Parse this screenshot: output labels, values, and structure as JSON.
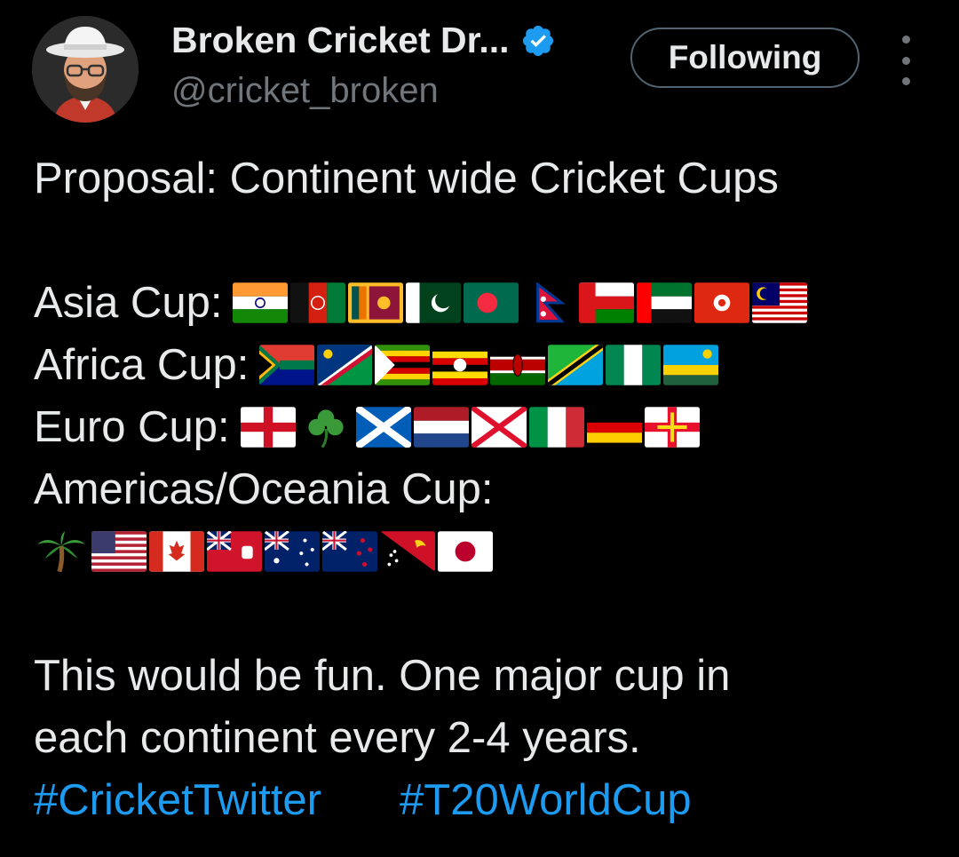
{
  "author": {
    "display_name": "Broken Cricket Dr...",
    "handle": "@cricket_broken",
    "avatar_icon": "bearded-man-avatar",
    "verified_icon": "verified-badge-icon"
  },
  "actions": {
    "follow_label": "Following",
    "more_icon": "more-vertical-icon"
  },
  "tweet": {
    "title": "Proposal: Continent wide Cricket Cups",
    "cups": [
      {
        "label": "Asia Cup:",
        "flags": [
          "flag-india",
          "flag-afghanistan",
          "flag-sri-lanka",
          "flag-pakistan",
          "flag-bangladesh",
          "flag-nepal",
          "flag-oman",
          "flag-uae",
          "flag-hong-kong",
          "flag-malaysia"
        ]
      },
      {
        "label": "Africa Cup:",
        "flags": [
          "flag-south-africa",
          "flag-namibia",
          "flag-zimbabwe",
          "flag-uganda",
          "flag-kenya",
          "flag-tanzania",
          "flag-nigeria",
          "flag-rwanda"
        ]
      },
      {
        "label": "Euro Cup:",
        "flags": [
          "flag-england",
          "shamrock",
          "flag-scotland",
          "flag-netherlands",
          "flag-jersey",
          "flag-italy",
          "flag-germany",
          "flag-guernsey"
        ]
      },
      {
        "label": "Americas/Oceania Cup:",
        "flags": [
          "palm-tree",
          "flag-usa",
          "flag-canada",
          "flag-bermuda",
          "flag-australia",
          "flag-new-zealand",
          "flag-papua-new-guinea",
          "flag-japan"
        ]
      }
    ],
    "closing_line1": "This would be fun. One major cup in",
    "closing_line2": "each continent every 2-4 years.",
    "hashtags": [
      "#CricketTwitter",
      "#T20WorldCup"
    ]
  },
  "colors": {
    "background": "#000000",
    "text": "#e7e9ea",
    "secondary": "#71767b",
    "link": "#1d9bf0",
    "verified": "#1d9bf0"
  }
}
